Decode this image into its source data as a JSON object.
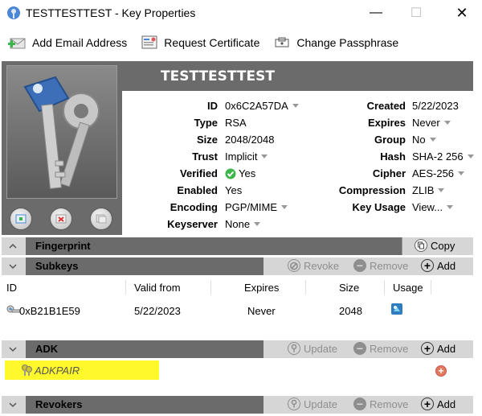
{
  "window": {
    "title": "TESTTESTTEST - Key Properties"
  },
  "toolbar": {
    "add_email": "Add Email Address",
    "request_cert": "Request Certificate",
    "change_pass": "Change Passphrase"
  },
  "key": {
    "name": "TESTTESTTEST",
    "left": [
      {
        "label": "ID",
        "value": "0x6C2A57DA",
        "dropdown": true
      },
      {
        "label": "Type",
        "value": "RSA",
        "dropdown": false
      },
      {
        "label": "Size",
        "value": "2048/2048",
        "dropdown": false
      },
      {
        "label": "Trust",
        "value": "Implicit",
        "dropdown": true
      },
      {
        "label": "Verified",
        "value": "Yes",
        "dropdown": false
      },
      {
        "label": "Enabled",
        "value": "Yes",
        "dropdown": false
      },
      {
        "label": "Encoding",
        "value": "PGP/MIME",
        "dropdown": true
      },
      {
        "label": "Keyserver",
        "value": "None",
        "dropdown": true
      }
    ],
    "right": [
      {
        "label": "Created",
        "value": "5/22/2023",
        "dropdown": false
      },
      {
        "label": "Expires",
        "value": "Never",
        "dropdown": true
      },
      {
        "label": "Group",
        "value": "No",
        "dropdown": true
      },
      {
        "label": "Hash",
        "value": "SHA-2 256",
        "dropdown": true
      },
      {
        "label": "Cipher",
        "value": "AES-256",
        "dropdown": true
      },
      {
        "label": "Compression",
        "value": "ZLIB",
        "dropdown": true
      },
      {
        "label": "Key Usage",
        "value": "View...",
        "dropdown": true
      }
    ]
  },
  "sections": {
    "fingerprint": {
      "title": "Fingerprint",
      "copy": "Copy"
    },
    "subkeys": {
      "title": "Subkeys",
      "revoke": "Revoke",
      "remove": "Remove",
      "add": "Add"
    },
    "adk": {
      "title": "ADK",
      "update": "Update",
      "remove": "Remove",
      "add": "Add"
    },
    "revokers": {
      "title": "Revokers",
      "update": "Update",
      "remove": "Remove",
      "add": "Add"
    }
  },
  "subkeys_table": {
    "headers": [
      "ID",
      "Valid from",
      "Expires",
      "Size",
      "Usage"
    ],
    "rows": [
      {
        "id": "0xB21B1E59",
        "valid_from": "5/22/2023",
        "expires": "Never",
        "size": "2048"
      }
    ]
  },
  "adk_list": [
    {
      "name": "ADKPAIR"
    }
  ],
  "colors": {
    "panel": "#6b6b6b",
    "highlight": "#fff82a",
    "verified_green": "#3cb54a"
  }
}
